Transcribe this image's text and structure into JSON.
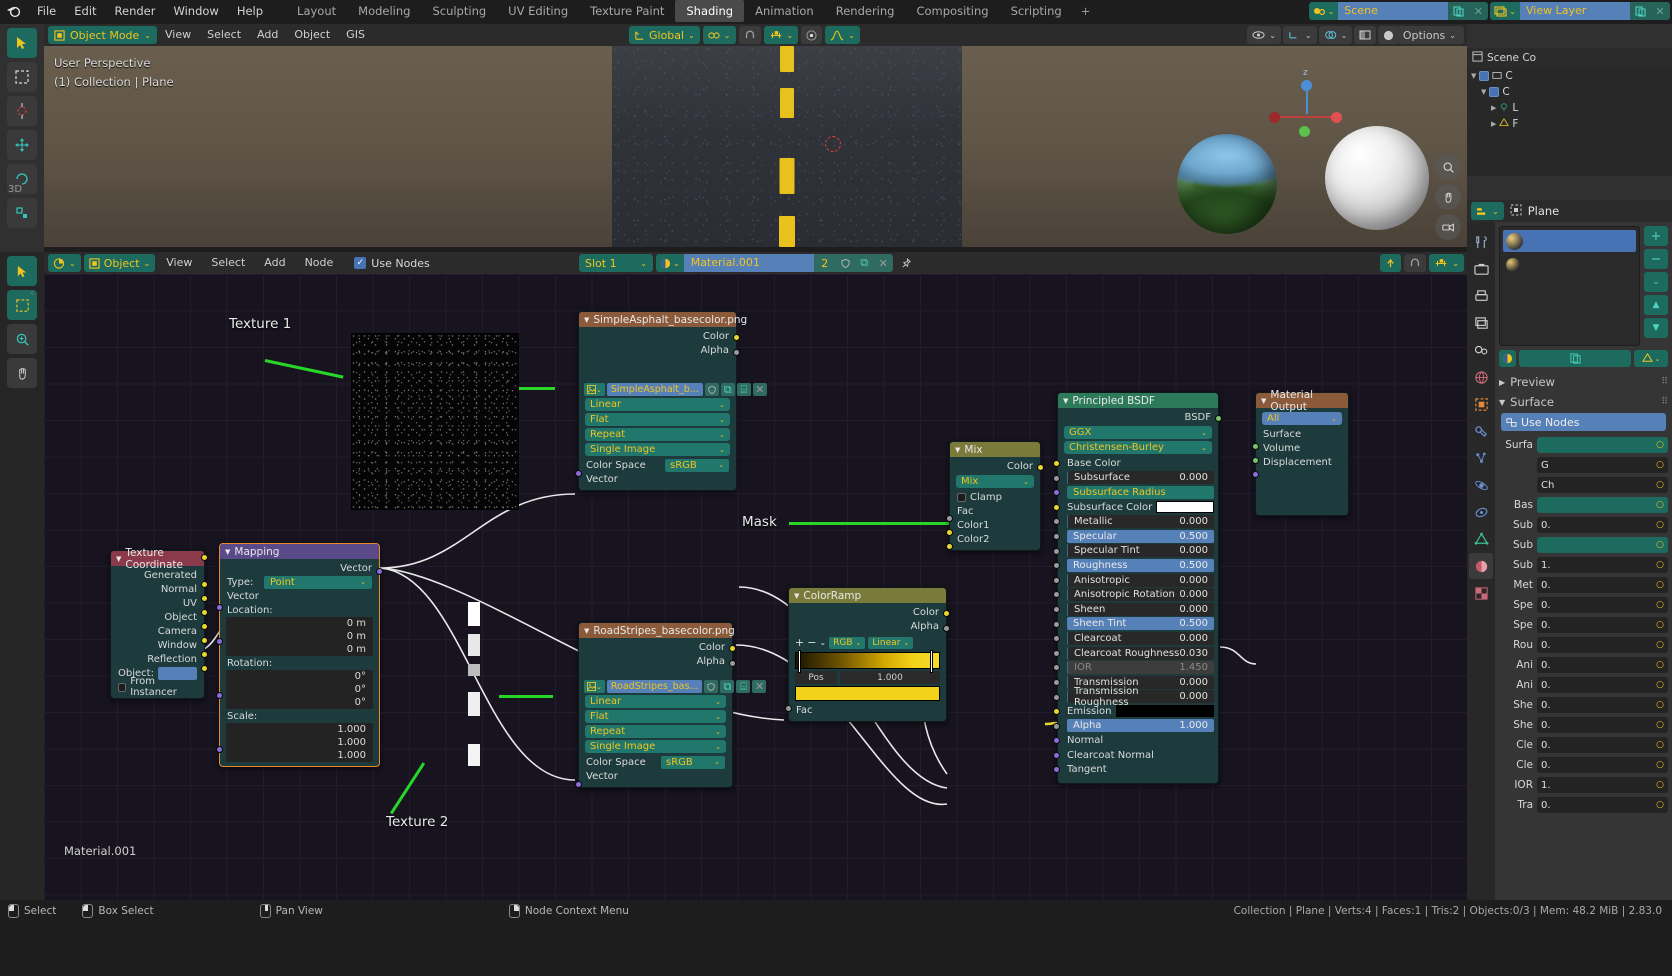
{
  "app": {
    "menus": [
      "File",
      "Edit",
      "Render",
      "Window",
      "Help"
    ],
    "workspace_tabs": [
      {
        "label": "Layout",
        "active": false
      },
      {
        "label": "Modeling",
        "active": false
      },
      {
        "label": "Sculpting",
        "active": false
      },
      {
        "label": "UV Editing",
        "active": false
      },
      {
        "label": "Texture Paint",
        "active": false
      },
      {
        "label": "Shading",
        "active": true
      },
      {
        "label": "Animation",
        "active": false
      },
      {
        "label": "Rendering",
        "active": false
      },
      {
        "label": "Compositing",
        "active": false
      },
      {
        "label": "Scripting",
        "active": false
      },
      {
        "label": "+",
        "active": false
      }
    ],
    "scene_name": "Scene",
    "view_layer_name": "View Layer"
  },
  "viewport": {
    "mode": "Object Mode",
    "menus": [
      "View",
      "Select",
      "Add",
      "Object",
      "GIS"
    ],
    "transform_orientation": "Global",
    "overlay_text_line1": "User Perspective",
    "overlay_text_line2": "(1) Collection | Plane"
  },
  "shader_editor": {
    "object_selector": "Object",
    "menus": [
      "View",
      "Select",
      "Add",
      "Node"
    ],
    "use_nodes_label": "Use Nodes",
    "use_nodes_checked": true,
    "slot": "Slot 1",
    "material": "Material.001",
    "material_users": "2",
    "footer_material": "Material.001"
  },
  "annotations": [
    {
      "label": "Texture 1"
    },
    {
      "label": "Texture 2"
    },
    {
      "label": "Mask"
    }
  ],
  "nodes": {
    "texture_coordinate": {
      "title": "Texture Coordinate",
      "outputs": [
        "Generated",
        "Normal",
        "UV",
        "Object",
        "Camera",
        "Window",
        "Reflection"
      ],
      "object_label": "Object:",
      "object_value": "",
      "from_instancer_label": "From Instancer"
    },
    "mapping": {
      "title": "Mapping",
      "output_label": "Vector",
      "type_label": "Type:",
      "type_value": "Point",
      "vector_label": "Vector",
      "location_label": "Location:",
      "location": [
        "0 m",
        "0 m",
        "0 m"
      ],
      "rotation_label": "Rotation:",
      "rotation": [
        "0°",
        "0°",
        "0°"
      ],
      "scale_label": "Scale:",
      "scale": [
        "1.000",
        "1.000",
        "1.000"
      ]
    },
    "simple_asphalt": {
      "title": "SimpleAsphalt_basecolor.png",
      "outputs": [
        "Color",
        "Alpha"
      ],
      "image_name": "SimpleAsphalt_b...",
      "interpolation": "Linear",
      "projection": "Flat",
      "extension": "Repeat",
      "source": "Single Image",
      "colorspace_label": "Color Space",
      "colorspace_value": "sRGB",
      "input_label": "Vector"
    },
    "road_stripes": {
      "title": "RoadStripes_basecolor.png",
      "outputs": [
        "Color",
        "Alpha"
      ],
      "image_name": "RoadStripes_bas...",
      "interpolation": "Linear",
      "projection": "Flat",
      "extension": "Repeat",
      "source": "Single Image",
      "colorspace_label": "Color Space",
      "colorspace_value": "sRGB",
      "input_label": "Vector"
    },
    "color_ramp": {
      "title": "ColorRamp",
      "outputs": [
        "Color",
        "Alpha"
      ],
      "mode": "RGB",
      "interpolation": "Linear",
      "pos_label": "Pos",
      "pos_value": "1.000",
      "input_label": "Fac"
    },
    "mix": {
      "title": "Mix",
      "output_label": "Color",
      "blend_mode": "Mix",
      "clamp_label": "Clamp",
      "clamp_checked": false,
      "inputs": [
        "Fac",
        "Color1",
        "Color2"
      ]
    },
    "principled_bsdf": {
      "title": "Principled BSDF",
      "output_label": "BSDF",
      "distribution": "GGX",
      "subsurface_method": "Christensen-Burley",
      "rows": [
        {
          "label": "Base Color",
          "value": "",
          "style": "plain",
          "socket": "yellow"
        },
        {
          "label": "Subsurface",
          "value": "0.000",
          "style": "dark",
          "socket": "grey"
        },
        {
          "label": "Subsurface Radius",
          "value": "",
          "style": "teal",
          "socket": "purple"
        },
        {
          "label": "Subsurface Color",
          "value": "",
          "style": "swatch-white",
          "socket": "yellow"
        },
        {
          "label": "Metallic",
          "value": "0.000",
          "style": "dark",
          "socket": "grey"
        },
        {
          "label": "Specular",
          "value": "0.500",
          "style": "blue",
          "socket": "grey"
        },
        {
          "label": "Specular Tint",
          "value": "0.000",
          "style": "dark",
          "socket": "grey"
        },
        {
          "label": "Roughness",
          "value": "0.500",
          "style": "blue",
          "socket": "grey"
        },
        {
          "label": "Anisotropic",
          "value": "0.000",
          "style": "dark",
          "socket": "grey"
        },
        {
          "label": "Anisotropic Rotation",
          "value": "0.000",
          "style": "dark",
          "socket": "grey"
        },
        {
          "label": "Sheen",
          "value": "0.000",
          "style": "dark",
          "socket": "grey"
        },
        {
          "label": "Sheen Tint",
          "value": "0.500",
          "style": "blue",
          "socket": "grey"
        },
        {
          "label": "Clearcoat",
          "value": "0.000",
          "style": "dark",
          "socket": "grey"
        },
        {
          "label": "Clearcoat Roughness",
          "value": "0.030",
          "style": "dark",
          "socket": "grey"
        },
        {
          "label": "IOR",
          "value": "1.450",
          "style": "greyed",
          "socket": "grey"
        },
        {
          "label": "Transmission",
          "value": "0.000",
          "style": "dark",
          "socket": "grey"
        },
        {
          "label": "Transmission Roughness",
          "value": "0.000",
          "style": "dark",
          "socket": "grey"
        },
        {
          "label": "Emission",
          "value": "",
          "style": "swatch-black",
          "socket": "yellow"
        },
        {
          "label": "Alpha",
          "value": "1.000",
          "style": "blue",
          "socket": "grey"
        },
        {
          "label": "Normal",
          "value": "",
          "style": "none",
          "socket": "purple"
        },
        {
          "label": "Clearcoat Normal",
          "value": "",
          "style": "none",
          "socket": "purple"
        },
        {
          "label": "Tangent",
          "value": "",
          "style": "none",
          "socket": "purple"
        }
      ]
    },
    "material_output": {
      "title": "Material Output",
      "target": "All",
      "inputs": [
        "Surface",
        "Volume",
        "Displacement"
      ]
    }
  },
  "outliner": {
    "title": "Scene Co",
    "rows": [
      "C",
      "C",
      "L",
      "F"
    ]
  },
  "properties": {
    "breadcrumb": "Plane",
    "preview_label": "Preview",
    "surface_label": "Surface",
    "use_nodes_label": "Use Nodes",
    "rows": [
      {
        "label": "Surfa",
        "value": ""
      },
      {
        "label": "",
        "value": "G"
      },
      {
        "label": "",
        "value": "Ch"
      },
      {
        "label": "Bas",
        "value": ""
      },
      {
        "label": "Sub",
        "value": "0."
      },
      {
        "label": "Sub",
        "value": ""
      },
      {
        "label": "Sub",
        "value": "1."
      },
      {
        "label": "Met",
        "value": "0."
      },
      {
        "label": "Spe",
        "value": "0."
      },
      {
        "label": "Spe",
        "value": "0."
      },
      {
        "label": "Rou",
        "value": "0."
      },
      {
        "label": "Ani",
        "value": "0."
      },
      {
        "label": "Ani",
        "value": "0."
      },
      {
        "label": "She",
        "value": "0."
      },
      {
        "label": "She",
        "value": "0."
      },
      {
        "label": "Cle",
        "value": "0."
      },
      {
        "label": "Cle",
        "value": "0."
      },
      {
        "label": "IOR",
        "value": "1."
      },
      {
        "label": "Tra",
        "value": "0."
      }
    ]
  },
  "status_bar": {
    "items": [
      {
        "label": "Select"
      },
      {
        "label": "Box Select"
      },
      {
        "label": "Pan View"
      },
      {
        "label": "Node Context Menu"
      }
    ],
    "right_text": "Collection | Plane | Verts:4 | Faces:1 | Tris:2 | Objects:0/3 | Mem: 48.2 MiB | 2.83.0"
  },
  "colors": {
    "accent_teal": "#1d6a5e",
    "accent_blue": "#5680b8",
    "text_yellow": "#f0c420",
    "annotation_green": "#27d627",
    "node_header_image": "#8a5a3a",
    "node_header_shader": "#2d7a5a",
    "node_header_output": "#8a5a3a",
    "node_header_converter": "#7a7a3a",
    "node_header_input": "#8a3a4a",
    "node_header_vector": "#5a4a8a"
  }
}
